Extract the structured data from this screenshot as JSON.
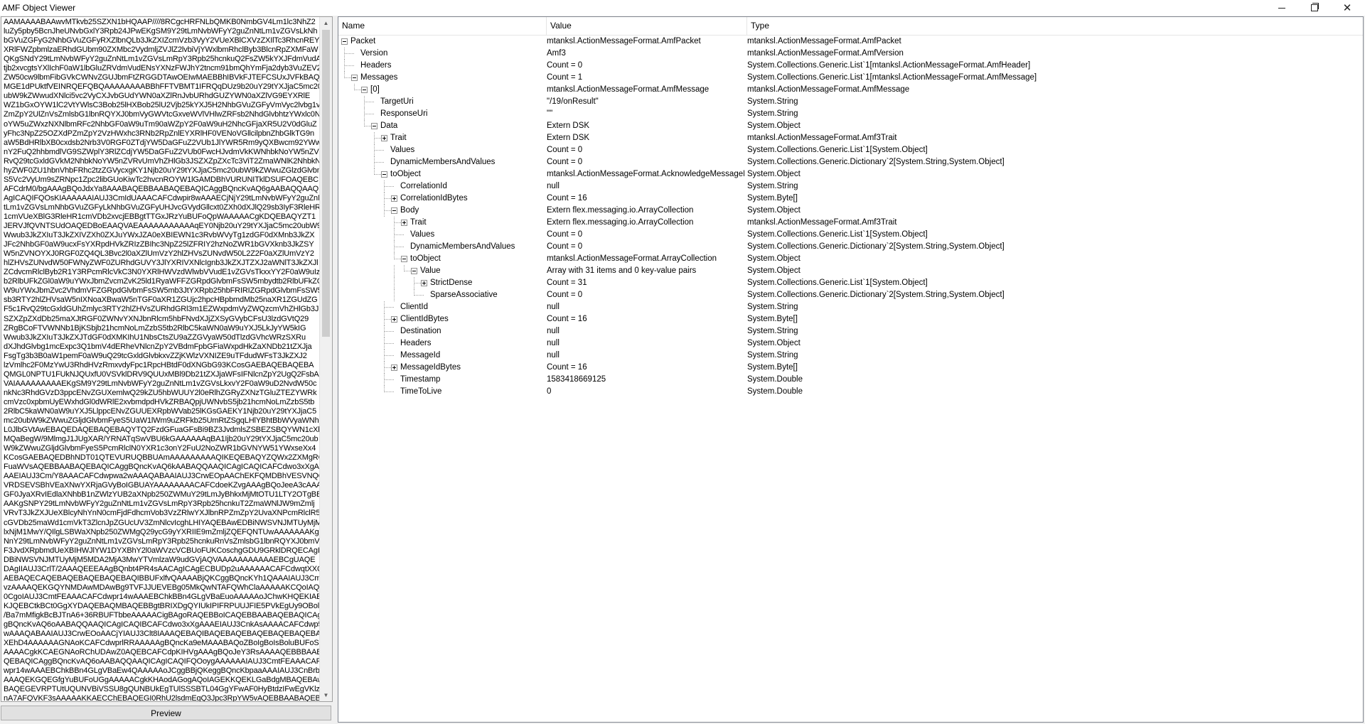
{
  "window": {
    "title": "AMF Object Viewer"
  },
  "left_panel": {
    "raw_text_lines": [
      "AAMAAAABAAwvMTkvb25SZXN1bHQAAP////8RCgcHRFNLbQMKB0NmbGV4Lm1lc3NhZ2",
      "luZy5pby5BcnJheUNvbGxlY3Rpb24JPwEKgSM9Y29tLmNvbWFyY2guZnNtLm1vZGVsLkNh",
      "bGVuZGFyG2NhbGVuZGFyRXZlbnQLb3JkZXIZcmVzb3VyY2VUeXBlCXVzZXIlTc3RhcnREY",
      "XRlFWZpbmlzaERhdGUbm90ZXMbc2VydmljZVJlZ2lvbiVjYWxlbmRhclByb3BlcnRpZXMFaW",
      "QKgSNdY29tLmNvbWFyY2guZnNtLm1vZGVsLmRpY3Rpb25hcnkuQ2FsZW5kYXJFdmVudA",
      "tjb2xvcgtsYXlIchF0aW1lbGluZRVdmVudENsYXNzFWJhY2tncm91bmQhYmFja2dyb3VuZEV2",
      "ZW50cw9lbmFibGVkCWNvZGUJbmFtZRGGDTAwOEIwMAEBBhIBVkFJTEFCSUxJVFkBAQ",
      "MGE1dPUktfVEINRQEFQBQAAAAAAAABBhFFTVBMT1IFRQqDUz9b20uY29tYXJjaC5mc20",
      "ubW9kZWwudXNlci5vc2VyCXJvbGUdYWN0aXZlRnJvbURhdGUZYWN0aXZlVG9EYXRlE",
      "WZ1bGxOYW1lC2VtYWlsC3Bob25lHXBob25lU2Vjb25kYXJ5H2NhbGVuZGFyVmVyc2lvbg1v",
      "ZmZpY2UlZnVsZmlsbG1lbnRQYXJ0bmVyGWVtcGxveWVlVHlwZRFsb2NhdGlvbhtzYWxlc0N",
      "oYW5uZWxzNXNlbmRFc2NhbGF0aW9uTm90aWZpY2F0aW9uH2NhcGFjaXR5U2V0dGluZ",
      "yFhc3NpZ25OZXdPZmZpY2VzHWxhc3RNb2RpZnlEYXRlHF0VENoVGllcilpbnZhbGlkTG9n",
      "aW5BdHRlbXB0cxdsb2Nrb3V0RGF0ZTdjYW5DaGFuZ2VUb1JlYWR5Rm9yQXBwcm92YWw",
      "nY2FuQ2hhbmdlVG9SZWplY3RlZCdjYW5DaGFuZ2VUb0FwcHJvdmVkKWNhbkNoYW5nZV",
      "RvQ29tcGxldGVkM2NhbkNoYW5nZVRvUmVhZHlGb3JSZXZpZXcTc3ViT2ZmaWNlK2NhbkN",
      "hyZWF0ZU1hbnVhbFRhc2tzZGVycxgKY1Njb20uY29tYXJjaC5mc20ubW9kZWwuZGlzdGlvbmFye",
      "S5Vc2VyUm9sZRNpc1Zpc2libGUoKiwTc2hvcnROYW1lGAMDBhVURUNITklDSUFOAQEBC",
      "AFCdrM0/bgAAAgBQoJdxYa8AAABAQEBBAABAQEBAQICAggBQncKvAQ6gAABAQQAAQIC",
      "AgICAQIFQOsKIAAAAAAIAUJ3CmIdUAAACAFCdwpir8wAAAECjNjY29tLmNvbWFyY2guZnN",
      "tLm1vZGVsLmNhbGVuZGFyLkNhbGVuZGFyUHJvcGVydGllcxt0ZXh0dXJlQ29sb3IyF3RleHR",
      "1cmVUeXBlG3RleHR1cmVDb2xvcjEBBgtTTGxJRzYuBUFoQpWAAAAACgKDQEBAQYZT1",
      "JERVJfQVNTSUdOAQEDBoEAAQVAEAAAAAAAAAAAqEY0Njb20uY29tYXJjaC5mc20ubW9kZ",
      "Wwub3JkZXIuT3JkZXIVZXh0ZXJuYWxJZA0eXBIEWN1c3RvbWVyTg1zdGF0dXMnb3JkZX",
      "JFc2NhbGF0aW9ucxFsYXRpdHVkZRIzZBIhc3NpZ25lZFRIY2hzNoZWR1bGVXknb3JkZSY",
      "W5nZVNOYXJ0RGF0ZQ4QL3Bvc2l0aXZlUmVzY2hlZHVsZUNvdW50L2Z2F0aXZlUmVzY2",
      "hlZHVsZUNvdW50FWNyZWF0ZURhdGUVY3JlYXRIVXNlcIgnb3JkZXJTZXJ2aWNlT3JkZXJl",
      "ZCdvcmRlclByb2R1Y3RPcmRlcVkC3N0YXRlHWVzdWlwbVVudE1vZGVsTkxxYY2F0aW9uIzZXdN",
      "b2RlbUFkZGl0aW9uYWxJbmZvcmZvK25ld1RyaWFFZGRpdGlvbmFsSW5mbydtb2RlbUFkZGl0a",
      "W9uYWxJbmZvc2VhdmVFZGRpdGlvbmFsSW5mb3JtYXRpb25hbFRIRIZGRpdGlvbmFsSW5",
      "sb3RTY2hlZHVsaW5nIXNoaXBwaW5nTGF0aXR1ZGUjc2hpcHBpbmdMb25naXR1ZGUdZG",
      "F5c1RvQ29tcGxldGUhZmlyc3RTY2hlZHVsZURhdGRl3m1EZWxpdmVyZWQzcmVhZHlGb3J",
      "SZXZpZXdDb25maXJtRGF0ZWNvYXNJbnRlcm5hbFNvdXJjZXSyGVybCFsU3lzdGVtQ29",
      "ZRgBCoFTVWNNb1BjKSbjb21hcmNoLmZzbS5tb2RlbC5kaWN0aW9uYXJ5LkJyYW5kIG",
      "Wwub3JkZXIuT3JkZXJTdGF0dXMKIhU1NbsCtsZU9aZZGVyaW50dTlzdGVhcWRzSXRu",
      "dXJhdGlvbg1mcExpc3Q1bmV4dERheVNlcnZpY2VBdmFpbGFiaWxpdHkZaXNDb21tZXJja",
      "FsgTg3b3B0aW1pemF0aW9uQ29tcGxldGlvbkxvZZjKWlzVXNIZE9uTFdudWFsT3JkZXJ2",
      "lzVmlhc2F0MzYwU3RhdHVzRmxvdyFpc1RpcHBtdF0dXNGbG93KCosGAEBAQEBAQEBA",
      "QMGL0NPTU1FUkNJQUxfU0VSVklDRV9QUUxMBl9Db21tZXJjaWFsIFNlcnZpY2UgQ2FsbA",
      "VAIAAAAAAAAAEKgSM9Y29tLmNvbWFyY2guZnNtLm1vZGVsLkxvY2F0aW9uD2NvdW50c",
      "nkNc3RhdGVzD3ppcENvZGUXemlwQ29kZU5hbWUUY2l0eRlhZGRyZXNzTGluZTEZYWRk",
      "cmVzc0xpbmUyEWxhdGl0dWRlE2xvbmdpdHVkZRBAQpjUWNvbS5jb21hcmNoLmZzbS5tb",
      "2RlbC5kaWN0aW9uYXJ5LlppcENvZGUUEXRpbWVab25lKGsGAEKY1Njb20uY29tYXJjaC5",
      "mc20ubW9kZWwuZGljdGlvbmFyeS5UaW1lWm9uZRFkb25UmRtZSgqLHlYBhtBbWVyaWNhL",
      "L0JlbGVtAwEBAQEDAQEBAQEBAQYTQ2FzdGFuaGFsBi9BZ3JvdmlsZSBEZSBQYWN1cXhcmEg",
      "MQaBegW/9MlmgJ1JUgXAR/YRNATqSwVBU6kGAAAAAAqBA1Ijb20uY29tYXJjaC5mc20ub",
      "W9kZWwuZGljdGlvbmFyeS5PcmRlclN0YXR1c3onY2FuU2NoZWR1bGVNYW51YWxseXx4",
      "KCosGAEBAQEDBhNDT01QTEVURUQBBUAmAAAAAAAAAQIKEQEBAQYZQWx2ZXMgRG",
      "FuaWVsAQEBBAABAQEBAQICAggBQncKvAQ6kAABAQQAAQICAgICAQICAFCdwo3xXgA",
      "AAEIAUJ3Cm/Y8AAACAFCdwpwa2wAAAQABAAIAUJ3CrwEOpAAChEKFQMDBhVESVNQQ",
      "VRDSEVSBhVEaXNwYXRjaGVyBoIGBUAYAAAAAAAACAFCdoeKZvgAAAgBQoJeeA3cAAA",
      "GF0JyaXRvIEdlaXNhbB1nZWlzYUB2aXNpb250ZWMuY29tLmJyBhkxMjMtOTU1LTY2OTgBB",
      "AAKgSNPY29tLmNvbWFyY2guZnNtLm1vZGVsLmRpY3Rpb25hcnkuT2ZmaWNlJW9mZmlj",
      "VRvT3JkZXJUeXBlcyNhYnN0cmFjdFdhcmVob3VzZRlwYXJlbnRPZmZpY2UvaXNPcmRlclR5",
      "cGVDb25maWd1cmVkT3ZlcnJpZGUcUV3ZmNlcvIcghLHIYAQEBAwEDBiNWSVNJMTUyMjM5MD",
      "lxNjM1MwY/QIlgLSBWaXNpb250ZWMgQ29ycG9yYXRIIE9mZmljZQEFQNTUwAAAAAAAKgS",
      "NnY29tLmNvbWFyY2guZnNtLm1vZGVsLmRpY3Rpb25hcnkuRnVsZmlsbG1lbnRQYXJ0bmVy",
      "F3JvdXRpbmdUeXBIHWJlYW1DYXBhY2l0aWVzcVCBUoFUKCoschgGDU9GRklDRQECAgI",
      "DBiNWSVNJMTUyMjM5MDA2MjA3MwYTVmlzaW9udGVjAQVAAAAAAAAAAAEBCgUAQE",
      "DAgIIAUJ3CrlT/2AAAQEEEAAgBQnbt4PR4sAACAgICAgECBUDp2uAAAAAACAFCdwqtXXQA",
      "AEBAQECAQEBAQEBAQEBAQEBAQIBBUFxlfvQAAAABjQKCggBQncKYh1QAAAIAUJ3CmK",
      "vzAAAAQEKGQYNMDAwMDAwBg9TVFJJUEVEBg05MkQwNTAFQWhClaAAAAAKCQoIAQY",
      "0CgoIAUJ3CmtFEAAACAFCdwpr14wAAAEBChkBBn4GLgVBaEuoAAAAAoJChwKHQEKIAE",
      "KJQEBCtkBCt0GgXYDAQEBAQMBAQEBBgtBRIXDgQYIUkIPIFRPUUJFIE5PVkEgUy9OBolybT",
      "/Ba7mMfigkBcBJTnA6+36RBUFTbbeAAAAACigBAgoRAQEBBoICAQEBBAABAQEBAQICAg",
      "gBQncKvAQ6oAABAQQAAQICAgICAQIBCAFCdwo3xXgAAAEIAUJ3CnkAsAAAACAFCdwp5ky",
      "wAAAQABAAIAUJ3CrwEOoAACjYIAUJ3Clt8IAAAQEBAQIBAQEBAQEBAQEBAQEBAQEBAgEFQ",
      "XEhD4AAAAAAGNAoKCAFCdwprlRRAAAAAgBQncKa9eMAAABAQoZBoIgBoIsBoluBUFoS67A",
      "AAAACgkKCAEGNAoRChUDAwZ0AQEBCAFCdpKIHVgAAAgBQoJeY3RsAAAAQEBBBAABA",
      "QEBAQICAggBQncKvAQ6oAABAQQAAQICAgICAQIFQOoygAAAAAAIAUJ3CmtFEAAACAFCd",
      "wpr14wAAAEBChkBBn4GLgVBaEw4QAAAAAoJCggBBjQKeggBQncKbpaaAAAIAUJ3CnBrbA",
      "AAAQEKGQEGfgYuBUFoUGgAAAAACgkKHAodAGogAQoIAGEKKQEKLGaBdgMBAQEBAweE",
      "BAQEGEVRPTUtUQUNVBiVSSU8gQUNBUkEgTUlSSSBTL04GgYFwAF0HyBtdzIFwEgVKlz",
      "nA7AFQVKF3sAAAAAKKAECChEBAQEGI0RhU2lsdmEgQ3Jpc3RpYW5vAQEBBAABAQEBAQ",
      "QICAggBQncKvAQ6oAABAQQAAQICAgICAQIBCAFCdwo3xXgAAAEIAUJ3CnxSTAAACAFCd"
    ],
    "preview_button_label": "Preview"
  },
  "tree": {
    "columns": {
      "name": "Name",
      "value": "Value",
      "type": "Type"
    },
    "rows": [
      {
        "depth": 0,
        "toggle": "minus",
        "name": "Packet",
        "value": "mtanksl.ActionMessageFormat.AmfPacket",
        "type": "mtanksl.ActionMessageFormat.AmfPacket"
      },
      {
        "depth": 1,
        "toggle": "",
        "name": "Version",
        "value": "Amf3",
        "type": "mtanksl.ActionMessageFormat.AmfVersion"
      },
      {
        "depth": 1,
        "toggle": "",
        "name": "Headers",
        "value": "Count = 0",
        "type": "System.Collections.Generic.List`1[mtanksl.ActionMessageFormat.AmfHeader]"
      },
      {
        "depth": 1,
        "toggle": "minus",
        "name": "Messages",
        "value": "Count = 1",
        "type": "System.Collections.Generic.List`1[mtanksl.ActionMessageFormat.AmfMessage]"
      },
      {
        "depth": 2,
        "toggle": "minus",
        "name": "[0]",
        "value": "mtanksl.ActionMessageFormat.AmfMessage",
        "type": "mtanksl.ActionMessageFormat.AmfMessage"
      },
      {
        "depth": 3,
        "toggle": "",
        "name": "TargetUri",
        "value": "\"/19/onResult\"",
        "type": "System.String"
      },
      {
        "depth": 3,
        "toggle": "",
        "name": "ResponseUri",
        "value": "\"\"",
        "type": "System.String"
      },
      {
        "depth": 3,
        "toggle": "minus",
        "name": "Data",
        "value": "Extern DSK",
        "type": "System.Object"
      },
      {
        "depth": 4,
        "toggle": "plus",
        "name": "Trait",
        "value": "Extern DSK",
        "type": "mtanksl.ActionMessageFormat.Amf3Trait"
      },
      {
        "depth": 4,
        "toggle": "",
        "name": "Values",
        "value": "Count = 0",
        "type": "System.Collections.Generic.List`1[System.Object]"
      },
      {
        "depth": 4,
        "toggle": "",
        "name": "DynamicMembersAndValues",
        "value": "Count = 0",
        "type": "System.Collections.Generic.Dictionary`2[System.String,System.Object]"
      },
      {
        "depth": 4,
        "toggle": "minus",
        "name": "toObject",
        "value": "mtanksl.ActionMessageFormat.AcknowledgeMessageExt",
        "type": "System.Object"
      },
      {
        "depth": 5,
        "toggle": "",
        "name": "CorrelationId",
        "value": "null",
        "type": "System.String"
      },
      {
        "depth": 5,
        "toggle": "plus",
        "name": "CorrelationIdBytes",
        "value": "Count = 16",
        "type": "System.Byte[]"
      },
      {
        "depth": 5,
        "toggle": "minus",
        "name": "Body",
        "value": "Extern flex.messaging.io.ArrayCollection",
        "type": "System.Object"
      },
      {
        "depth": 6,
        "toggle": "plus",
        "name": "Trait",
        "value": "Extern flex.messaging.io.ArrayCollection",
        "type": "mtanksl.ActionMessageFormat.Amf3Trait"
      },
      {
        "depth": 6,
        "toggle": "",
        "name": "Values",
        "value": "Count = 0",
        "type": "System.Collections.Generic.List`1[System.Object]"
      },
      {
        "depth": 6,
        "toggle": "",
        "name": "DynamicMembersAndValues",
        "value": "Count = 0",
        "type": "System.Collections.Generic.Dictionary`2[System.String,System.Object]"
      },
      {
        "depth": 6,
        "toggle": "minus",
        "name": "toObject",
        "value": "mtanksl.ActionMessageFormat.ArrayCollection",
        "type": "System.Object"
      },
      {
        "depth": 7,
        "toggle": "minus",
        "name": "Value",
        "value": "Array with 31 items and 0 key-value pairs",
        "type": "System.Object"
      },
      {
        "depth": 8,
        "toggle": "plus",
        "name": "StrictDense",
        "value": "Count = 31",
        "type": "System.Collections.Generic.List`1[System.Object]"
      },
      {
        "depth": 8,
        "toggle": "",
        "name": "SparseAssociative",
        "value": "Count = 0",
        "type": "System.Collections.Generic.Dictionary`2[System.String,System.Object]"
      },
      {
        "depth": 5,
        "toggle": "",
        "name": "ClientId",
        "value": "null",
        "type": "System.String"
      },
      {
        "depth": 5,
        "toggle": "plus",
        "name": "ClientIdBytes",
        "value": "Count = 16",
        "type": "System.Byte[]"
      },
      {
        "depth": 5,
        "toggle": "",
        "name": "Destination",
        "value": "null",
        "type": "System.String"
      },
      {
        "depth": 5,
        "toggle": "",
        "name": "Headers",
        "value": "null",
        "type": "System.Object"
      },
      {
        "depth": 5,
        "toggle": "",
        "name": "MessageId",
        "value": "null",
        "type": "System.String"
      },
      {
        "depth": 5,
        "toggle": "plus",
        "name": "MessageIdBytes",
        "value": "Count = 16",
        "type": "System.Byte[]"
      },
      {
        "depth": 5,
        "toggle": "",
        "name": "Timestamp",
        "value": "1583418669125",
        "type": "System.Double"
      },
      {
        "depth": 5,
        "toggle": "",
        "name": "TimeToLive",
        "value": "0",
        "type": "System.Double"
      }
    ]
  },
  "icons": {
    "minimize": "minimize-icon",
    "maximize": "restore-icon",
    "close": "close-icon",
    "scroll_up": "arrow-up-icon",
    "scroll_down": "arrow-down-icon"
  }
}
